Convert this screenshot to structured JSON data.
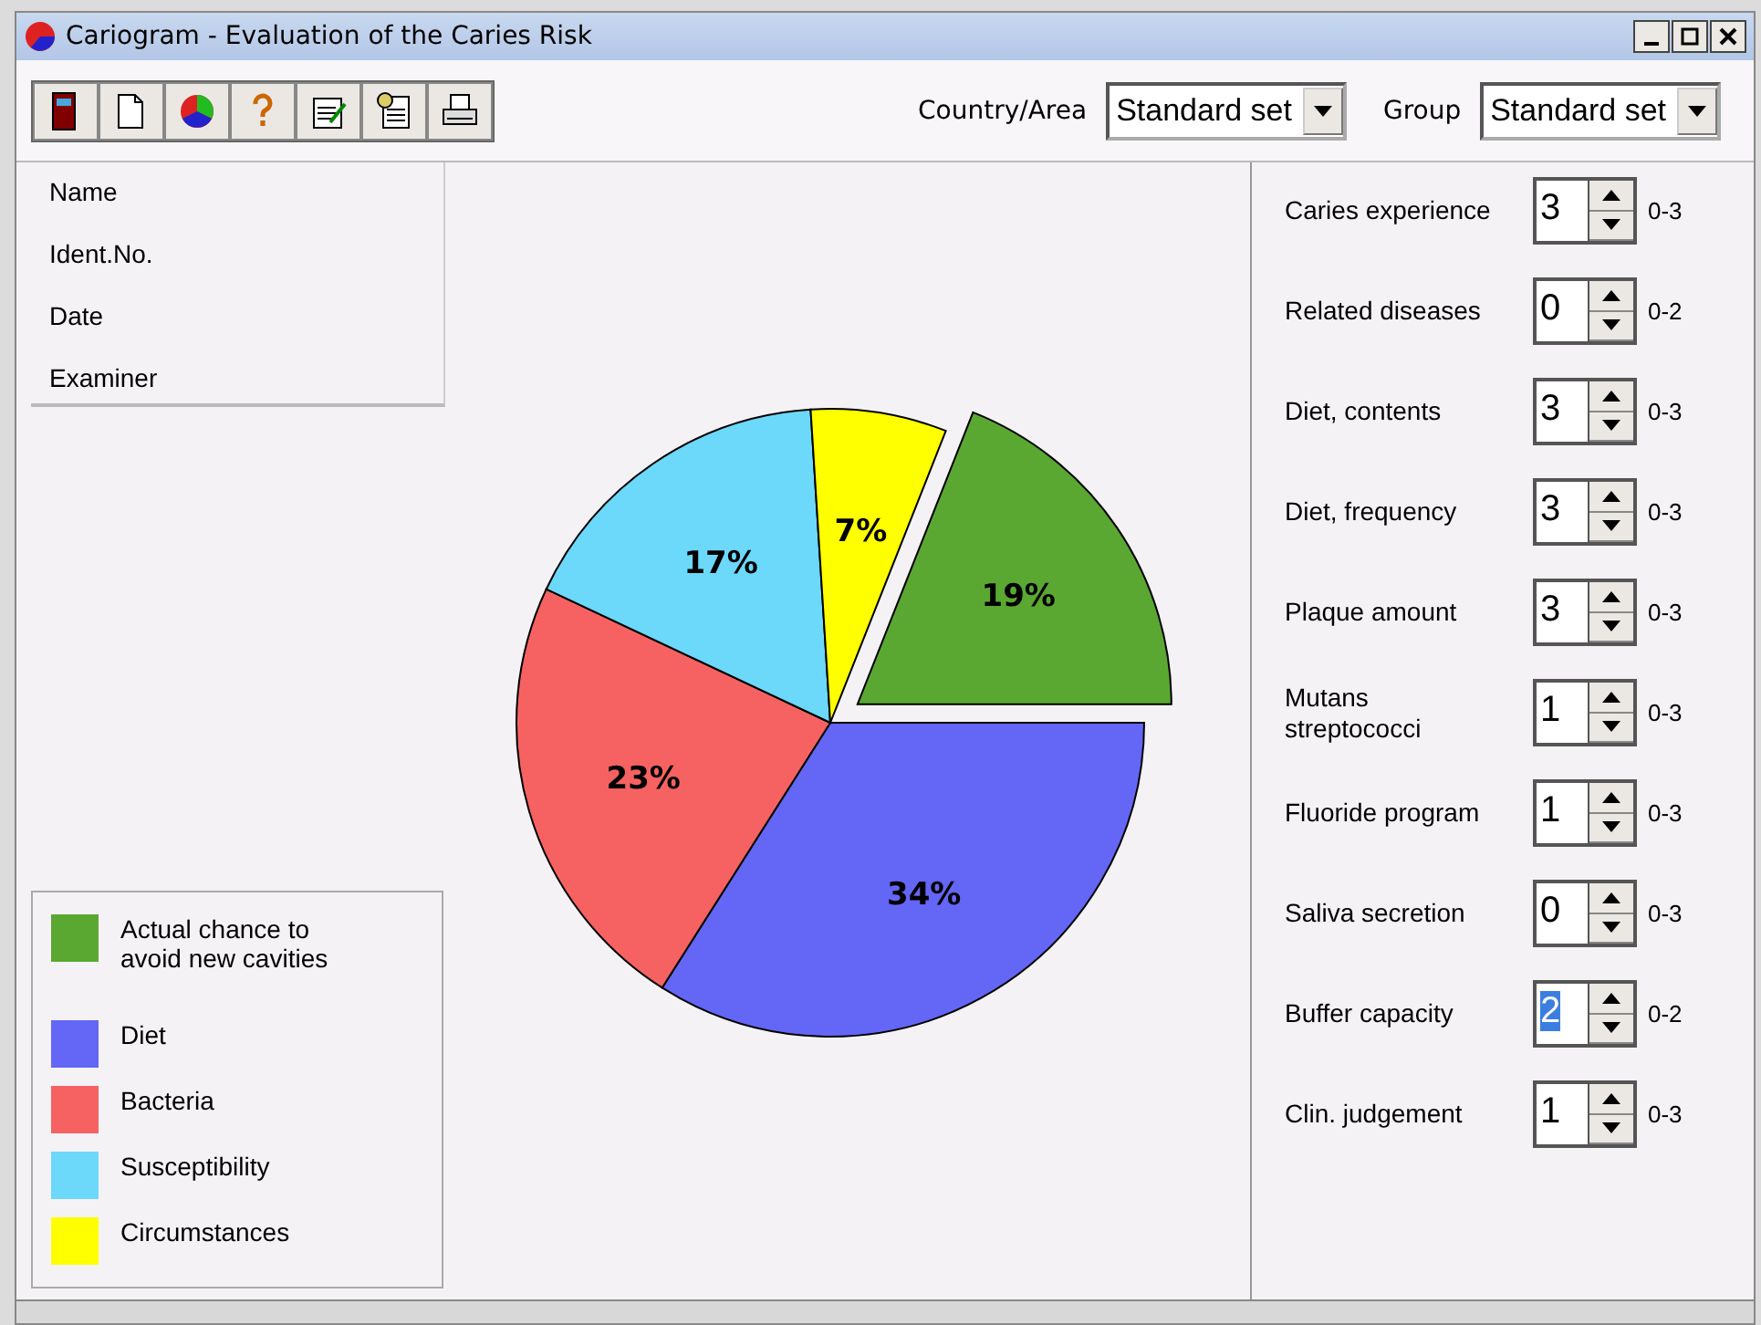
{
  "window": {
    "title": "Cariogram - Evaluation of the Caries Risk"
  },
  "selectors": [
    {
      "label": "Country/Area",
      "value": "Standard set"
    },
    {
      "label": "Group",
      "value": "Standard set"
    }
  ],
  "patient_fields": [
    "Name",
    "Ident.No.",
    "Date",
    "Examiner"
  ],
  "chart": {
    "slices": [
      {
        "exploded": true
      },
      {
        "exploded": false
      },
      {
        "exploded": false
      },
      {
        "exploded": false
      },
      {
        "exploded": false
      }
    ],
    "chart_data": {
      "type": "pie",
      "categories": [
        "Actual chance to avoid new cavities",
        "Diet",
        "Bacteria",
        "Susceptibility",
        "Circumstances"
      ],
      "values": [
        19,
        34,
        23,
        17,
        7
      ],
      "colors": [
        "#5aa832",
        "#6466f5",
        "#f66262",
        "#6cd8fa",
        "#ffff00"
      ],
      "data_labels": true,
      "value_labels": [
        "19%",
        "34%",
        "23%",
        "17%",
        "7%"
      ]
    }
  },
  "parameters": [
    {
      "label": "Caries experience",
      "value": "3",
      "range": "0-3",
      "selected": false
    },
    {
      "label": "Related diseases",
      "value": "0",
      "range": "0-2",
      "selected": false
    },
    {
      "label": "Diet, contents",
      "value": "3",
      "range": "0-3",
      "selected": false
    },
    {
      "label": "Diet, frequency",
      "value": "3",
      "range": "0-3",
      "selected": false
    },
    {
      "label": "Plaque amount",
      "value": "3",
      "range": "0-3",
      "selected": false
    },
    {
      "label": "Mutans streptococci",
      "value": "1",
      "range": "0-3",
      "selected": false
    },
    {
      "label": "Fluoride program",
      "value": "1",
      "range": "0-3",
      "selected": false
    },
    {
      "label": "Saliva secretion",
      "value": "0",
      "range": "0-3",
      "selected": false
    },
    {
      "label": "Buffer capacity",
      "value": "2",
      "range": "0-2",
      "selected": true
    },
    {
      "label": "Clin. judgement",
      "value": "1",
      "range": "0-3",
      "selected": false
    }
  ]
}
